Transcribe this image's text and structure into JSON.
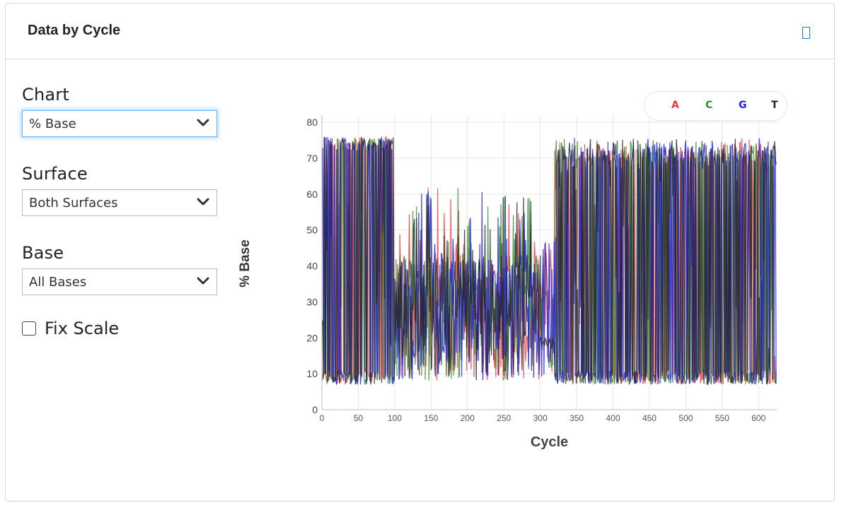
{
  "panel": {
    "title": "Data by Cycle",
    "expand_icon": "expand-icon"
  },
  "controls": {
    "chart": {
      "label": "Chart",
      "value": "% Base"
    },
    "surface": {
      "label": "Surface",
      "value": "Both Surfaces"
    },
    "base": {
      "label": "Base",
      "value": "All Bases"
    },
    "fix_scale": {
      "label": "Fix Scale",
      "checked": false
    }
  },
  "colors": {
    "A": "#e8393a",
    "C": "#2e8b2e",
    "G": "#2020e0",
    "T": "#222222",
    "accent": "#1f6fd1"
  },
  "chart_data": {
    "type": "line",
    "xlabel": "Cycle",
    "ylabel": "% Base",
    "xlim": [
      0,
      625
    ],
    "ylim": [
      0,
      82
    ],
    "xticks": [
      0,
      50,
      100,
      150,
      200,
      250,
      300,
      350,
      400,
      450,
      500,
      550,
      600
    ],
    "yticks": [
      0,
      10,
      20,
      30,
      40,
      50,
      60,
      70,
      80
    ],
    "grid": true,
    "legend_position": "top-right",
    "series": [
      {
        "name": "A",
        "color": "#e8393a"
      },
      {
        "name": "C",
        "color": "#2e8b2e"
      },
      {
        "name": "G",
        "color": "#2020e0"
      },
      {
        "name": "T",
        "color": "#222222"
      }
    ],
    "regions": [
      {
        "x_start": 1,
        "x_end": 100,
        "y_low": 7,
        "y_high": 75,
        "note": "values alternate between low and high"
      },
      {
        "x_start": 100,
        "x_end": 320,
        "y_low": 7,
        "y_high": 60,
        "note": "values mostly between 10 and 45"
      },
      {
        "x_start": 320,
        "x_end": 624,
        "y_low": 7,
        "y_high": 76,
        "note": "values alternate between low and high"
      }
    ]
  }
}
